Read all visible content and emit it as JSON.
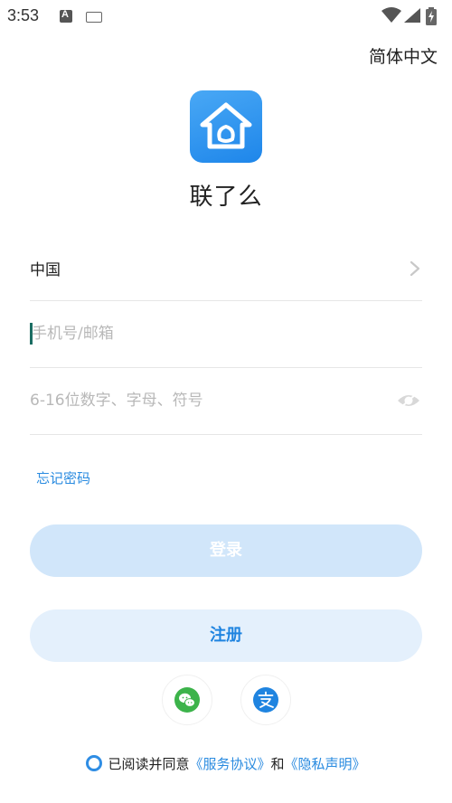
{
  "status_bar": {
    "time": "3:53"
  },
  "header": {
    "language": "简体中文"
  },
  "app": {
    "name": "联了么"
  },
  "form": {
    "country": "中国",
    "phone_placeholder": "手机号/邮箱",
    "password_placeholder": "6-16位数字、字母、符号",
    "forgot_password": "忘记密码"
  },
  "buttons": {
    "login": "登录",
    "register": "注册"
  },
  "social": {
    "icons": [
      "wechat-icon",
      "alipay-icon"
    ]
  },
  "agreement": {
    "prefix": "已阅读并同意",
    "terms": "《服务协议》",
    "conjunction": "和",
    "privacy": "《隐私声明》"
  },
  "colors": {
    "accent": "#2a8be0",
    "login_bg": "#d1e6fa",
    "register_bg": "#e4f0fc",
    "wechat": "#3cb34a",
    "alipay": "#1f84e0"
  }
}
